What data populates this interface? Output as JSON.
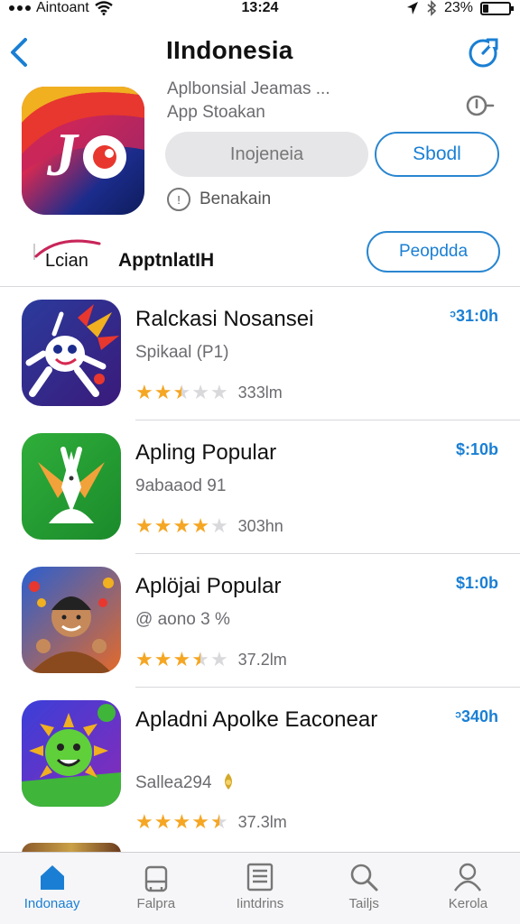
{
  "status_bar": {
    "carrier": "Aintoant",
    "time": "13:24",
    "battery": "23%",
    "battery_level": 0.23
  },
  "nav": {
    "title": "IIndonesia",
    "back_icon": "chevron-left-icon",
    "share_icon": "share-icon"
  },
  "app_header": {
    "subtitle_line1": "Aplbonsial Jeamas ...",
    "subtitle_line2": "App Stoakan",
    "get_button": "Inojeneia",
    "action_button": "Sbodl",
    "info_text": "Benakain",
    "colors": {
      "accent": "#1a7fd4"
    }
  },
  "tabs": {
    "tab1_label": "Lcian",
    "tab2_label": "ApptnlatIH",
    "tab_button": "Peopdda"
  },
  "apps": [
    {
      "name": "Ralckasi Nosansei",
      "subtitle": "Spikaal (P1)",
      "rating": 2.5,
      "count": "333lm",
      "price": "ᵓ31:0h"
    },
    {
      "name": "Apling Popular",
      "subtitle": "9abaaod 91",
      "rating": 4,
      "count": "303hn",
      "price": "$:10b"
    },
    {
      "name": "Aplöjai Popular",
      "subtitle": "@ aono 3 %",
      "rating": 3.5,
      "count": "37.2lm",
      "price": "$1:0b"
    },
    {
      "name": "Apladni Apolke Eaconear",
      "subtitle": "Sallea294",
      "rating": 4.5,
      "count": "37.3lm",
      "price": "ᵓ340h"
    }
  ],
  "bottom_tabs": [
    {
      "label": "Indonaay",
      "icon": "home-icon",
      "active": true
    },
    {
      "label": "Falpra",
      "icon": "bag-icon",
      "active": false
    },
    {
      "label": "Iintdrins",
      "icon": "list-icon",
      "active": false
    },
    {
      "label": "Tailjs",
      "icon": "search-icon",
      "active": false
    },
    {
      "label": "Kerola",
      "icon": "person-icon",
      "active": false
    }
  ]
}
